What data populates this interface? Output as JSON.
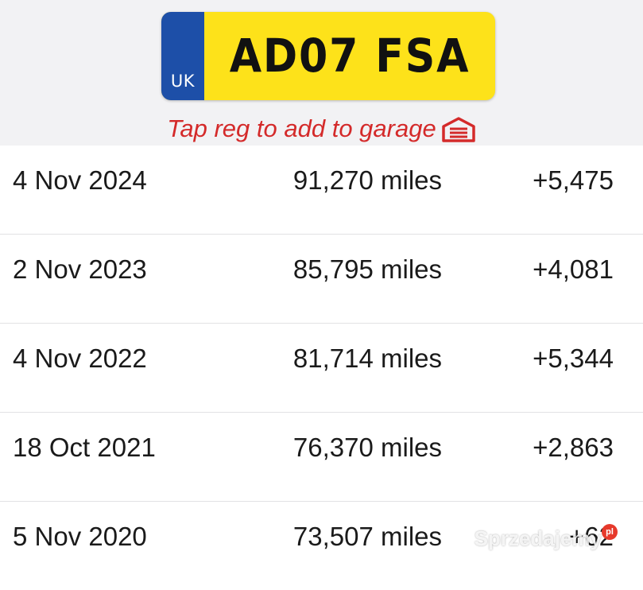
{
  "plate": {
    "country_code": "UK",
    "registration": "AD07 FSA"
  },
  "hint": {
    "text": "Tap reg to add to garage",
    "icon": "garage-icon"
  },
  "mileage_history": [
    {
      "date": "4 Nov 2024",
      "miles": "91,270 miles",
      "change": "+5,475"
    },
    {
      "date": "2 Nov 2023",
      "miles": "85,795 miles",
      "change": "+4,081"
    },
    {
      "date": "4 Nov 2022",
      "miles": "81,714 miles",
      "change": "+5,344"
    },
    {
      "date": "18 Oct 2021",
      "miles": "76,370 miles",
      "change": "+2,863"
    },
    {
      "date": "5 Nov 2020",
      "miles": "73,507 miles",
      "change": "+62"
    }
  ],
  "watermark": {
    "text": "Sprzedajemy",
    "badge": "pl"
  },
  "colors": {
    "plate_yellow": "#fde21a",
    "plate_blue": "#1d4fa8",
    "hint_red": "#d42a2a",
    "header_bg": "#f2f2f4"
  }
}
